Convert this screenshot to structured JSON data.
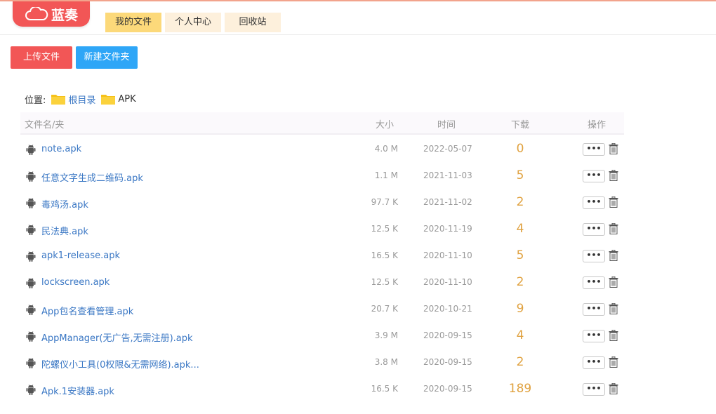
{
  "header": {
    "logo_text": "蓝奏",
    "tabs": [
      {
        "label": "我的文件",
        "active": true
      },
      {
        "label": "个人中心",
        "active": false
      },
      {
        "label": "回收站",
        "active": false
      }
    ]
  },
  "toolbar": {
    "upload_label": "上传文件",
    "new_folder_label": "新建文件夹"
  },
  "breadcrumb": {
    "prefix": "位置:",
    "root": "根目录",
    "current": "APK"
  },
  "table": {
    "columns": {
      "name": "文件名/夹",
      "size": "大小",
      "time": "时间",
      "downloads": "下载",
      "actions": "操作"
    },
    "more_label": "•••",
    "rows": [
      {
        "name": "note.apk",
        "size": "4.0 M",
        "time": "2022-05-07",
        "downloads": "0"
      },
      {
        "name": "任意文字生成二维码.apk",
        "size": "1.1 M",
        "time": "2021-11-03",
        "downloads": "5"
      },
      {
        "name": "毒鸡汤.apk",
        "size": "97.7 K",
        "time": "2021-11-02",
        "downloads": "2"
      },
      {
        "name": "民法典.apk",
        "size": "12.5 K",
        "time": "2020-11-19",
        "downloads": "4"
      },
      {
        "name": "apk1-release.apk",
        "size": "16.5 K",
        "time": "2020-11-10",
        "downloads": "5"
      },
      {
        "name": "lockscreen.apk",
        "size": "12.5 K",
        "time": "2020-11-10",
        "downloads": "2"
      },
      {
        "name": "App包名查看管理.apk",
        "size": "20.7 K",
        "time": "2020-10-21",
        "downloads": "9"
      },
      {
        "name": "AppManager(无广告,无需注册).apk",
        "size": "3.9 M",
        "time": "2020-09-15",
        "downloads": "4"
      },
      {
        "name": "陀螺仪小工具(0权限&无需网络).apk...",
        "size": "3.8 M",
        "time": "2020-09-15",
        "downloads": "2"
      },
      {
        "name": "Apk.1安装器.apk",
        "size": "16.5 K",
        "time": "2020-09-15",
        "downloads": "189"
      }
    ]
  },
  "colors": {
    "brand": "#f25656",
    "accent_blue": "#2ea6f7",
    "tab_active": "#fcd97a",
    "download_count": "#e0a240"
  }
}
